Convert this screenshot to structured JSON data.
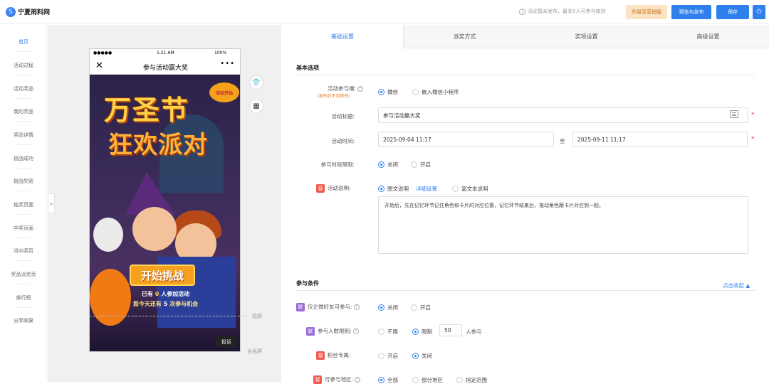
{
  "header": {
    "logo_mark": "S",
    "logo_text": "宁夏雨料网",
    "notice_icon": "info-icon",
    "notice": "活动暂未发布，最多5人可参与体验",
    "upgrade_label": "升级至营销版",
    "preview_publish_label": "预览与发布",
    "save_label": "保存",
    "power_icon": "⏻"
  },
  "sidebar": {
    "items": [
      {
        "label": "首页",
        "active": true
      },
      {
        "label": "活动过程"
      },
      {
        "label": "活动奖品"
      },
      {
        "label": "我的奖品"
      },
      {
        "label": "奖品详情"
      },
      {
        "label": "挑战成功"
      },
      {
        "label": "挑战失败"
      },
      {
        "label": "抽奖页面"
      },
      {
        "label": "中奖页面"
      },
      {
        "label": "没中奖页"
      },
      {
        "label": "奖品派完页"
      },
      {
        "label": "排行榜"
      },
      {
        "label": "分享效果"
      }
    ],
    "collapse_glyph": "«"
  },
  "phone": {
    "signal": "●●●●●",
    "time": "1:21 AM",
    "battery": "100%",
    "close_glyph": "✕",
    "title": "参与活动赢大奖",
    "more_glyph": "•••",
    "poster": {
      "title_line1": "万圣节",
      "title_line2": "狂欢派对",
      "tag": "活动开始",
      "start_button": "开始挑战",
      "info_line1_prefix": "已有",
      "info_line1_count": "0",
      "info_line1_suffix": "人参加活动",
      "info_line2_prefix": "您今天还有",
      "info_line2_count": "5",
      "info_line2_suffix": "次参与机会",
      "report_label": "投诉"
    },
    "short_screen_label": "短屏",
    "full_screen_label": "全面屏",
    "side_icons": [
      "shirt-icon",
      "grid-icon"
    ]
  },
  "tabs": [
    {
      "label": "基础设置",
      "active": true
    },
    {
      "label": "派奖方式"
    },
    {
      "label": "奖项设置"
    },
    {
      "label": "高级设置"
    }
  ],
  "basic": {
    "section_title": "基本选项",
    "participant_label": "活动参与端:",
    "participant_note": "(发布后不可修改)",
    "participant_options": [
      "微信",
      "嵌入微信小程序"
    ],
    "participant_selected": "微信",
    "title_label": "活动标题:",
    "title_value": "参与活动赢大奖",
    "time_label": "活动时间:",
    "time_start": "2025-09-04 11:17",
    "time_to": "至",
    "time_end": "2025-09-11 11:17",
    "time_limit_label": "参与时段限制:",
    "time_limit_options": [
      "关闭",
      "开启"
    ],
    "time_limit_selected": "关闭",
    "desc_badge": "营",
    "desc_label": "活动说明:",
    "desc_options": [
      "图文说明",
      "富文本说明"
    ],
    "desc_selected": "图文说明",
    "desc_link": "详细设置",
    "desc_text": "开始后，先在记忆环节记住角色和卡片的对应位置，记忆环节结束后，拖动角色跟卡片对应到一起。"
  },
  "conditions": {
    "section_title": "参与条件",
    "collapse_link": "点击收起 ▲",
    "wecom_badge": "联",
    "wecom_label": "仅企微好友可参与:",
    "wecom_options": [
      "关闭",
      "开启"
    ],
    "wecom_selected": "关闭",
    "limit_badge": "联",
    "limit_label": "参与人数限制:",
    "limit_options": [
      "不限",
      "限制"
    ],
    "limit_selected": "限制",
    "limit_value": "50",
    "limit_unit": "人参与",
    "fans_badge": "营",
    "fans_label": "粉丝专属:",
    "fans_options": [
      "开启",
      "关闭"
    ],
    "fans_selected": "关闭",
    "region_badge": "营",
    "region_label": "可参与地区:",
    "region_options": [
      "全部",
      "部分地区",
      "指定范围"
    ],
    "region_selected": "全部"
  },
  "colors": {
    "accent": "#2f80ed",
    "upgrade_bg": "#fbe3c4",
    "badge_red": "#ef5b4c",
    "badge_purple": "#9b6bd6"
  }
}
